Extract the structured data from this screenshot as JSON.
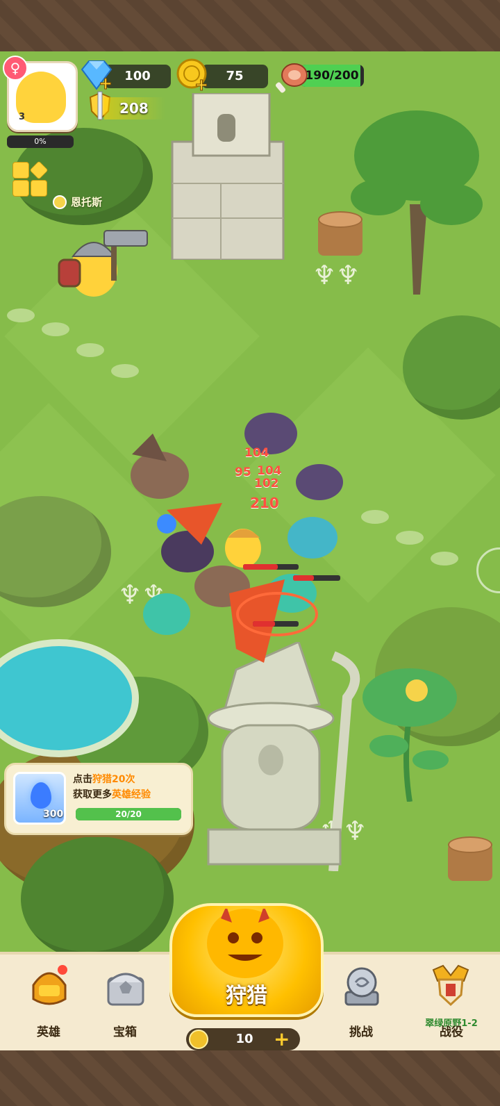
{
  "player": {
    "level": "3",
    "exp_percent": "0%",
    "hero_name": "恩托斯"
  },
  "resources": {
    "diamonds": "100",
    "gold": "75",
    "stamina": "190/200",
    "stamina_fraction": 0.95,
    "power": "208"
  },
  "battle": {
    "damage_numbers": [
      "104",
      "95",
      "102",
      "210",
      "104"
    ]
  },
  "quest": {
    "line1_prefix": "点击",
    "line1_highlight": "狩猎20次",
    "line2_prefix": "获取更多",
    "line2_highlight": "英雄经验",
    "reward_count": "300",
    "progress_text": "20/20",
    "progress_fraction": 1.0
  },
  "bottom_nav": {
    "heroes": "英雄",
    "chest": "宝箱",
    "hunt": "狩猎",
    "hunt_cost": "10",
    "challenge": "挑战",
    "campaign": "战役",
    "campaign_stage": "翠绿原野1-2"
  },
  "colors": {
    "grass": "#86bc4a",
    "accent_gold": "#ffc000",
    "stamina_green": "#4fd052",
    "quest_highlight": "#ff8a00"
  }
}
